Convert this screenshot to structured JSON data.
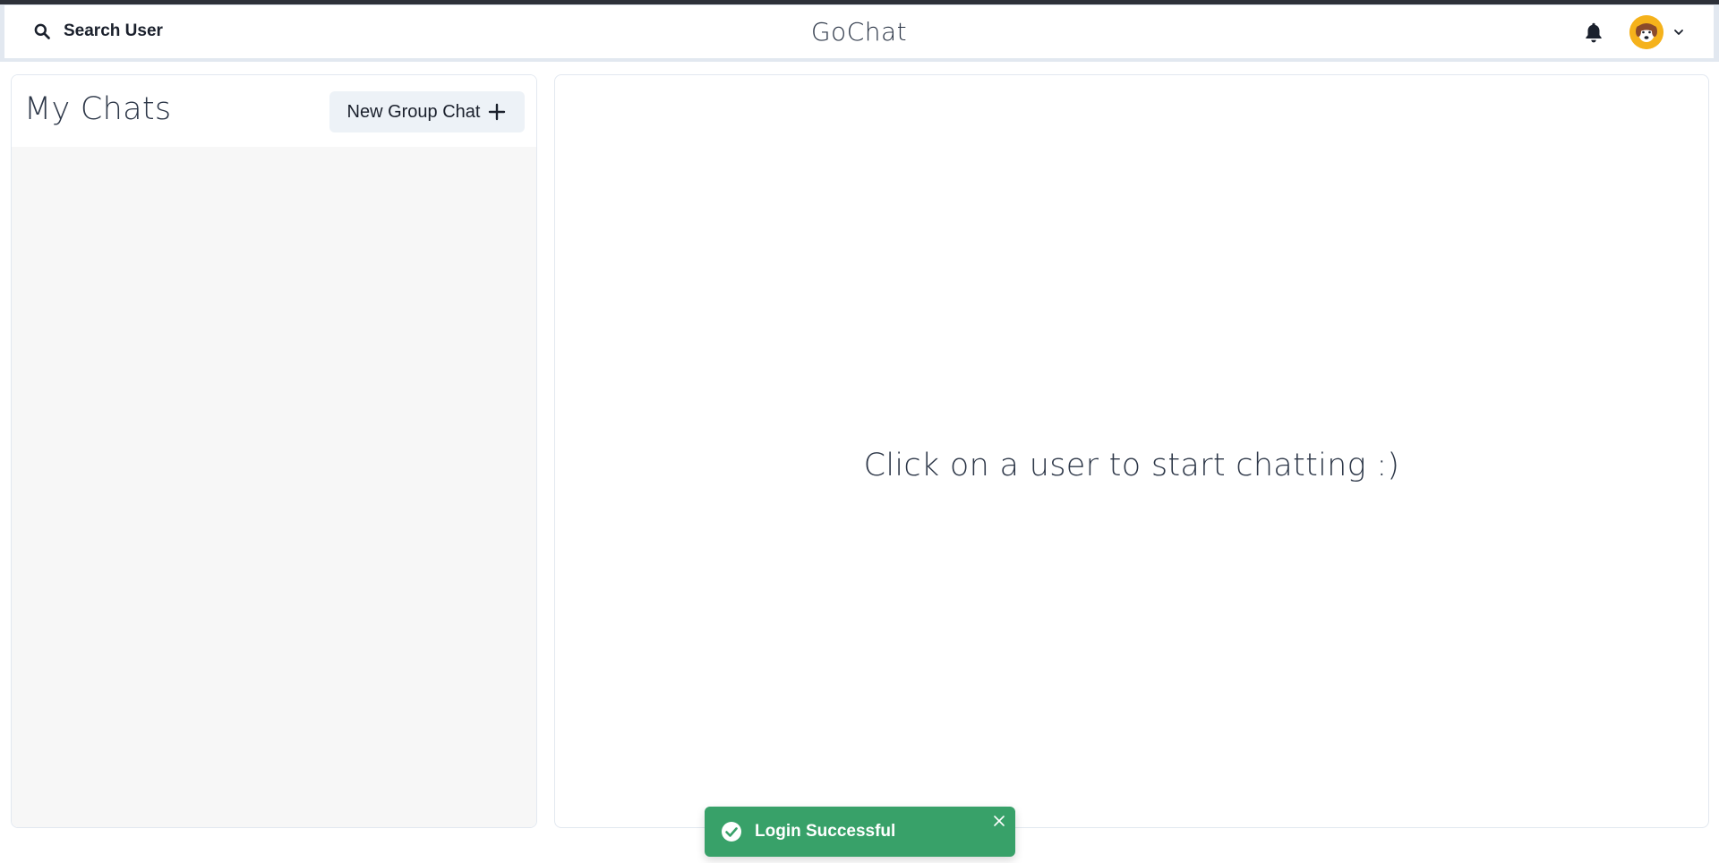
{
  "header": {
    "search_label": "Search User",
    "brand": "GoChat",
    "notification_icon": "bell-icon",
    "avatar_icon": "dog-avatar-icon",
    "menu_icon": "chevron-down-icon"
  },
  "sidebar": {
    "title": "My Chats",
    "new_group_label": "New Group Chat",
    "new_group_icon": "plus-icon",
    "chats": []
  },
  "main": {
    "placeholder": "Click on a user to start chatting :)"
  },
  "toast": {
    "message": "Login Successful",
    "status_icon": "check-circle-icon",
    "close_icon": "close-icon",
    "color": "#38a169"
  },
  "colors": {
    "accent_avatar": "#f5b21b",
    "header_bg": "#e2e8f0",
    "button_bg": "#edf2f7"
  }
}
